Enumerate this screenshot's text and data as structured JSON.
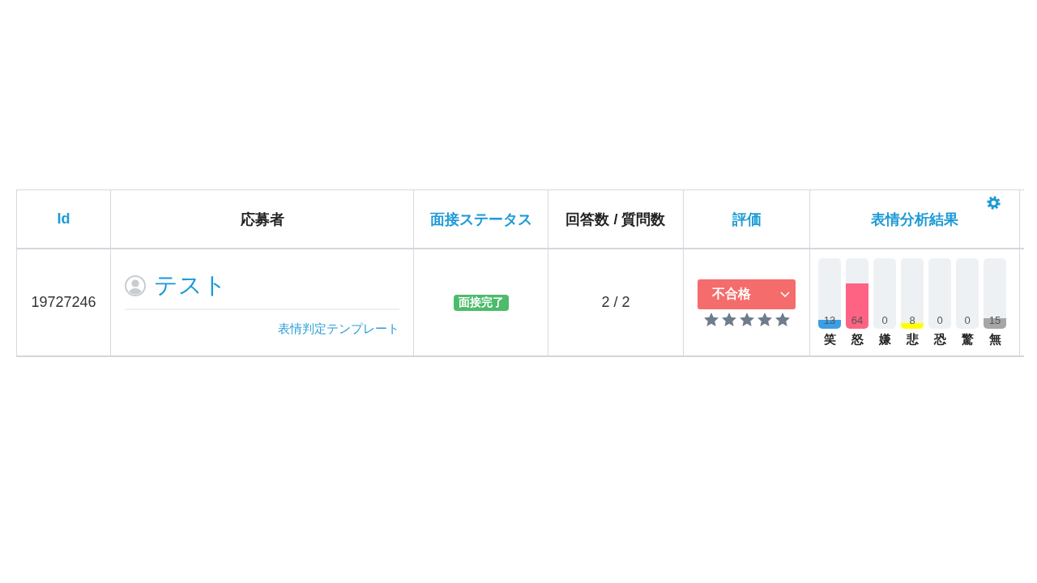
{
  "table": {
    "columns": [
      {
        "label": "Id",
        "sortable": true
      },
      {
        "label": "応募者",
        "sortable": false
      },
      {
        "label": "面接ステータス",
        "sortable": true
      },
      {
        "label": "回答数 / 質問数",
        "sortable": false
      },
      {
        "label": "評価",
        "sortable": true
      },
      {
        "label": "表情分析結果",
        "sortable": true
      }
    ],
    "rows": [
      {
        "id": "19727246",
        "applicant": {
          "name": "テスト",
          "template_link": "表情判定テンプレート"
        },
        "interview_status": {
          "label": "面接完了",
          "kind": "complete"
        },
        "answers": "2 / 2",
        "evaluation": {
          "value": "不合格",
          "stars": 5
        },
        "expressions": [
          {
            "label": "笑",
            "value": "13",
            "level": 0.13,
            "color": "#3a9fe6"
          },
          {
            "label": "怒",
            "value": "64",
            "level": 0.64,
            "color": "#ff6384"
          },
          {
            "label": "嫌",
            "value": "0"
          },
          {
            "label": "悲",
            "value": "8",
            "level": 0.08,
            "color": "#ffff00"
          },
          {
            "label": "恐",
            "value": "0"
          },
          {
            "label": "驚",
            "value": "0"
          },
          {
            "label": "無",
            "value": "15",
            "level": 0.15,
            "color": "#a6a6a6"
          }
        ]
      }
    ]
  }
}
